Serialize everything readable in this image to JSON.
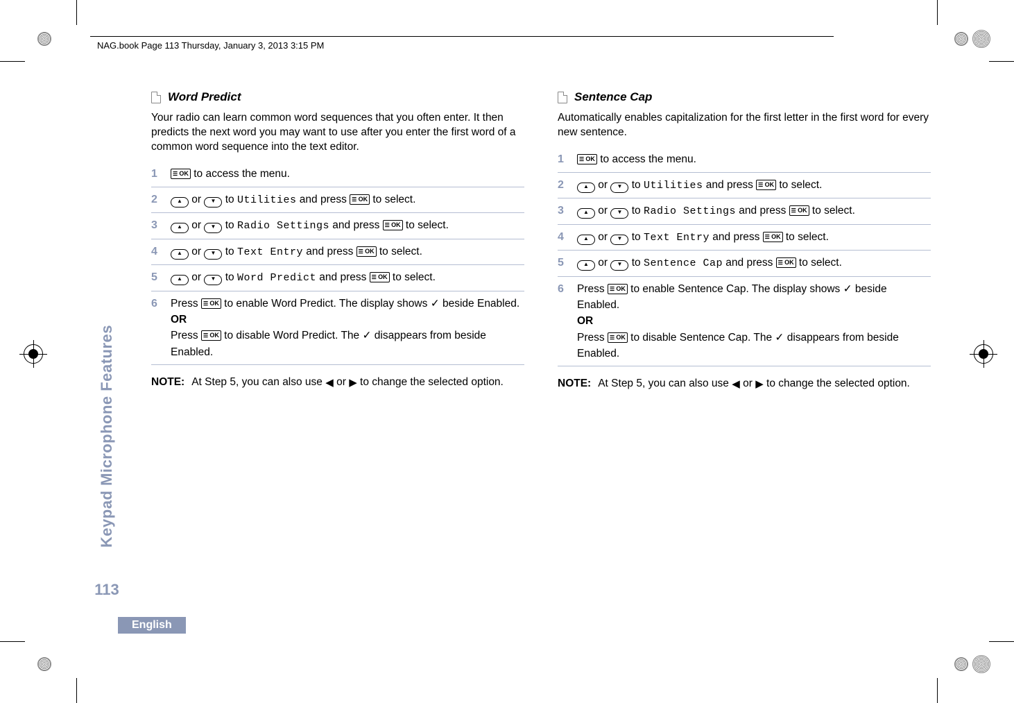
{
  "header": "NAG.book  Page 113  Thursday, January 3, 2013  3:15 PM",
  "sidebar_label": "Keypad Microphone Features",
  "page_number": "113",
  "footer_language": "English",
  "ok_button_label": "OK",
  "left": {
    "title": "Word Predict",
    "intro": "Your radio can learn common word sequences that you often enter. It then predicts the next word you may want to use after you enter the first word of a common word sequence into the text editor.",
    "steps": {
      "s1": {
        "n": "1",
        "tail": " to access the menu."
      },
      "s2": {
        "n": "2",
        "mid": " to ",
        "target": "Utilities",
        "press": " and press ",
        "tail": " to select."
      },
      "s3": {
        "n": "3",
        "mid": " to ",
        "target": "Radio Settings",
        "press": " and press ",
        "tail": " to select."
      },
      "s4": {
        "n": "4",
        "mid": " to ",
        "target": "Text Entry",
        "press": " and press ",
        "tail": " to select."
      },
      "s5": {
        "n": "5",
        "mid": " to ",
        "target": "Word Predict",
        "press": " and press ",
        "tail": " to select."
      },
      "s6": {
        "n": "6",
        "a_pre": "Press ",
        "a_post": " to enable Word Predict. The display shows ",
        "a_tail": " beside Enabled.",
        "or": "OR",
        "b_pre": "Press ",
        "b_post": " to disable Word Predict. The ",
        "b_tail": " disappears from beside Enabled."
      }
    },
    "note_label": "NOTE:",
    "note_pre": "At Step 5, you can also use ",
    "note_or": " or ",
    "note_post": " to change the selected option."
  },
  "right": {
    "title": "Sentence Cap",
    "intro": "Automatically enables capitalization for the first letter in the first word for every new sentence.",
    "steps": {
      "s1": {
        "n": "1",
        "tail": " to access the menu."
      },
      "s2": {
        "n": "2",
        "mid": " to ",
        "target": "Utilities",
        "press": " and press ",
        "tail": " to select."
      },
      "s3": {
        "n": "3",
        "mid": " to ",
        "target": "Radio Settings",
        "press": " and press ",
        "tail": " to select."
      },
      "s4": {
        "n": "4",
        "mid": " to ",
        "target": "Text Entry",
        "press": " and press ",
        "tail": " to select."
      },
      "s5": {
        "n": "5",
        "mid": " to ",
        "target": "Sentence Cap",
        "press": " and press ",
        "tail": " to select."
      },
      "s6": {
        "n": "6",
        "a_pre": "Press ",
        "a_post": " to enable Sentence Cap. The display shows ",
        "a_tail": " beside Enabled.",
        "or": "OR",
        "b_pre": "Press ",
        "b_post": " to disable Sentence Cap. The ",
        "b_tail": " disappears from beside Enabled."
      }
    },
    "note_label": "NOTE:",
    "note_pre": "At Step 5, you can also use ",
    "note_or": " or ",
    "note_post": " to change the selected option."
  }
}
